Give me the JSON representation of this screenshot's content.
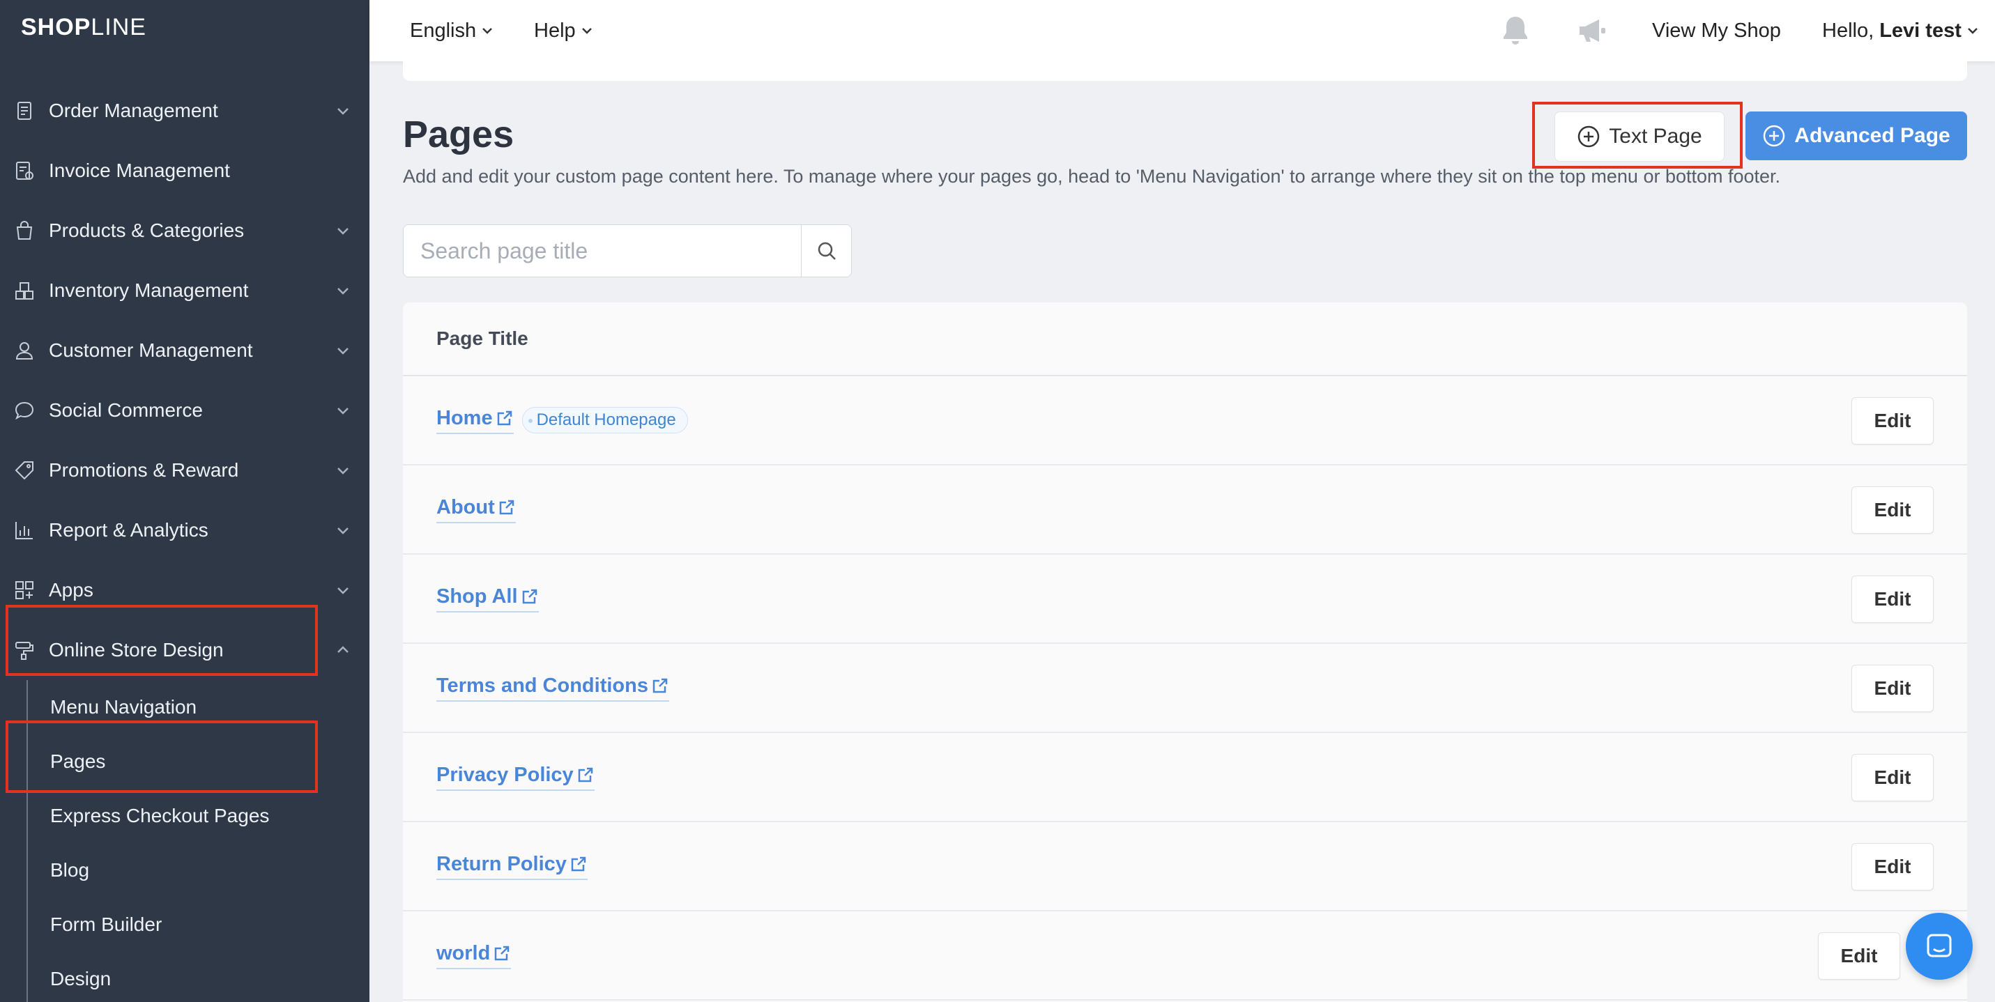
{
  "brand": {
    "logo_bold": "SHOP",
    "logo_light": "LINE"
  },
  "topbar": {
    "language": "English",
    "help": "Help",
    "view_shop": "View My Shop",
    "greeting": "Hello, ",
    "user_name": "Levi test"
  },
  "sidebar": {
    "items": [
      {
        "label": "Order Management",
        "icon": "clipboard-icon"
      },
      {
        "label": "Invoice Management",
        "icon": "invoice-icon"
      },
      {
        "label": "Products & Categories",
        "icon": "shopping-bag-icon"
      },
      {
        "label": "Inventory Management",
        "icon": "boxes-icon"
      },
      {
        "label": "Customer Management",
        "icon": "user-icon"
      },
      {
        "label": "Social Commerce",
        "icon": "chat-bubble-icon"
      },
      {
        "label": "Promotions & Reward",
        "icon": "tag-icon"
      },
      {
        "label": "Report & Analytics",
        "icon": "bar-chart-icon"
      },
      {
        "label": "Apps",
        "icon": "apps-grid-icon"
      },
      {
        "label": "Online Store Design",
        "icon": "paint-roller-icon"
      }
    ],
    "sub_items": [
      "Menu Navigation",
      "Pages",
      "Express Checkout Pages",
      "Blog",
      "Form Builder",
      "Design"
    ]
  },
  "main": {
    "title": "Pages",
    "description": "Add and edit your custom page content here. To manage where your pages go, head to 'Menu Navigation' to arrange where they sit on the top menu or bottom footer.",
    "text_page_button": "Text Page",
    "advanced_page_button": "Advanced Page",
    "search_placeholder": "Search page title",
    "table_header": "Page Title",
    "edit_label": "Edit",
    "default_badge": "Default Homepage",
    "rows": [
      "Home",
      "About",
      "Shop All",
      "Terms and Conditions",
      "Privacy Policy",
      "Return Policy",
      "world"
    ]
  },
  "colors": {
    "sidebar_bg": "#2f3846",
    "accent": "#4a8ee4",
    "link": "#4a86d8",
    "highlight": "#e0341f"
  }
}
